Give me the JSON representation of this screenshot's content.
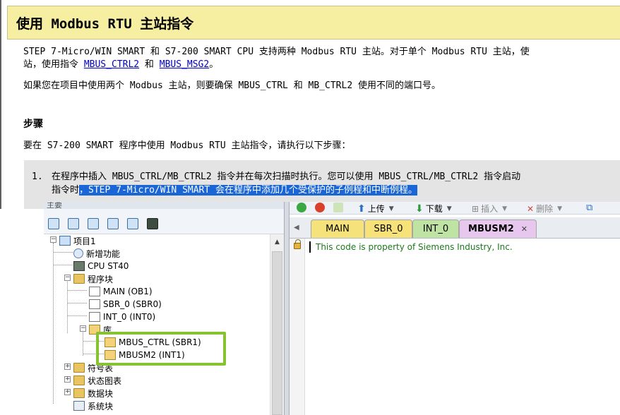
{
  "doc": {
    "title": "使用 Modbus RTU 主站指令",
    "para1_line1": "STEP 7-Micro/WIN SMART 和 S7-200 SMART CPU 支持两种 Modbus RTU 主站。对于单个 Modbus RTU 主站，使",
    "para1_line2_prefix": "站，使用指令 ",
    "link_ctrl2": "MBUS_CTRL2",
    "and_word": " 和 ",
    "link_msg2": "MBUS_MSG2",
    "para1_line2_suffix": "。",
    "para2": "如果您在项目中使用两个 Modbus 主站，则要确保 MBUS_CTRL 和 MB_CTRL2 使用不同的端口号。",
    "steps_heading": "步骤",
    "steps_intro": "要在 S7-200 SMART 程序中使用 Modbus RTU 主站指令，请执行以下步骤：",
    "step1_number": "1.",
    "step1_line1": "在程序中插入 MBUS_CTRL/MB_CTRL2 指令并在每次扫描时执行。您可以使用 MBUS_CTRL/MB_CTRL2 指令启动",
    "step1_line2_plain": "指令时",
    "step1_line2_selected": "，STEP 7-Micro/WIN SMART 会在程序中添加几个受保护的子例程和中断例程。"
  },
  "app": {
    "tree_header": "主要",
    "toolbar": {
      "upload": "上传",
      "download": "下载",
      "insert": "插入",
      "delete": "删除"
    },
    "tree": {
      "root": "项目1",
      "new_features": "新增功能",
      "cpu": "CPU ST40",
      "program_block": "程序块",
      "main": "MAIN (OB1)",
      "sbr0": "SBR_0 (SBR0)",
      "int0": "INT_0 (INT0)",
      "library": "库",
      "mbus_ctrl": "MBUS_CTRL (SBR1)",
      "mbusm2": "MBUSM2 (INT1)",
      "symbol_table": "符号表",
      "status_chart": "状态图表",
      "data_block": "数据块",
      "system_block": "系统块"
    },
    "tabs": {
      "main": "MAIN",
      "sbr0": "SBR_0",
      "int0": "INT_0",
      "mbusm2": "MBUSM2",
      "close": "✕"
    },
    "code_comment": "This code is property of Siemens Industry, Inc.",
    "colors": {
      "highlight_box": "#86c232",
      "selection": "#1a66d6",
      "doc_title_bg": "#f6eea0",
      "tab_main": "#f6e27a",
      "tab_sbr": "#f7e27a",
      "tab_int": "#bfe3a3",
      "tab_active": "#e7c7ee"
    }
  }
}
